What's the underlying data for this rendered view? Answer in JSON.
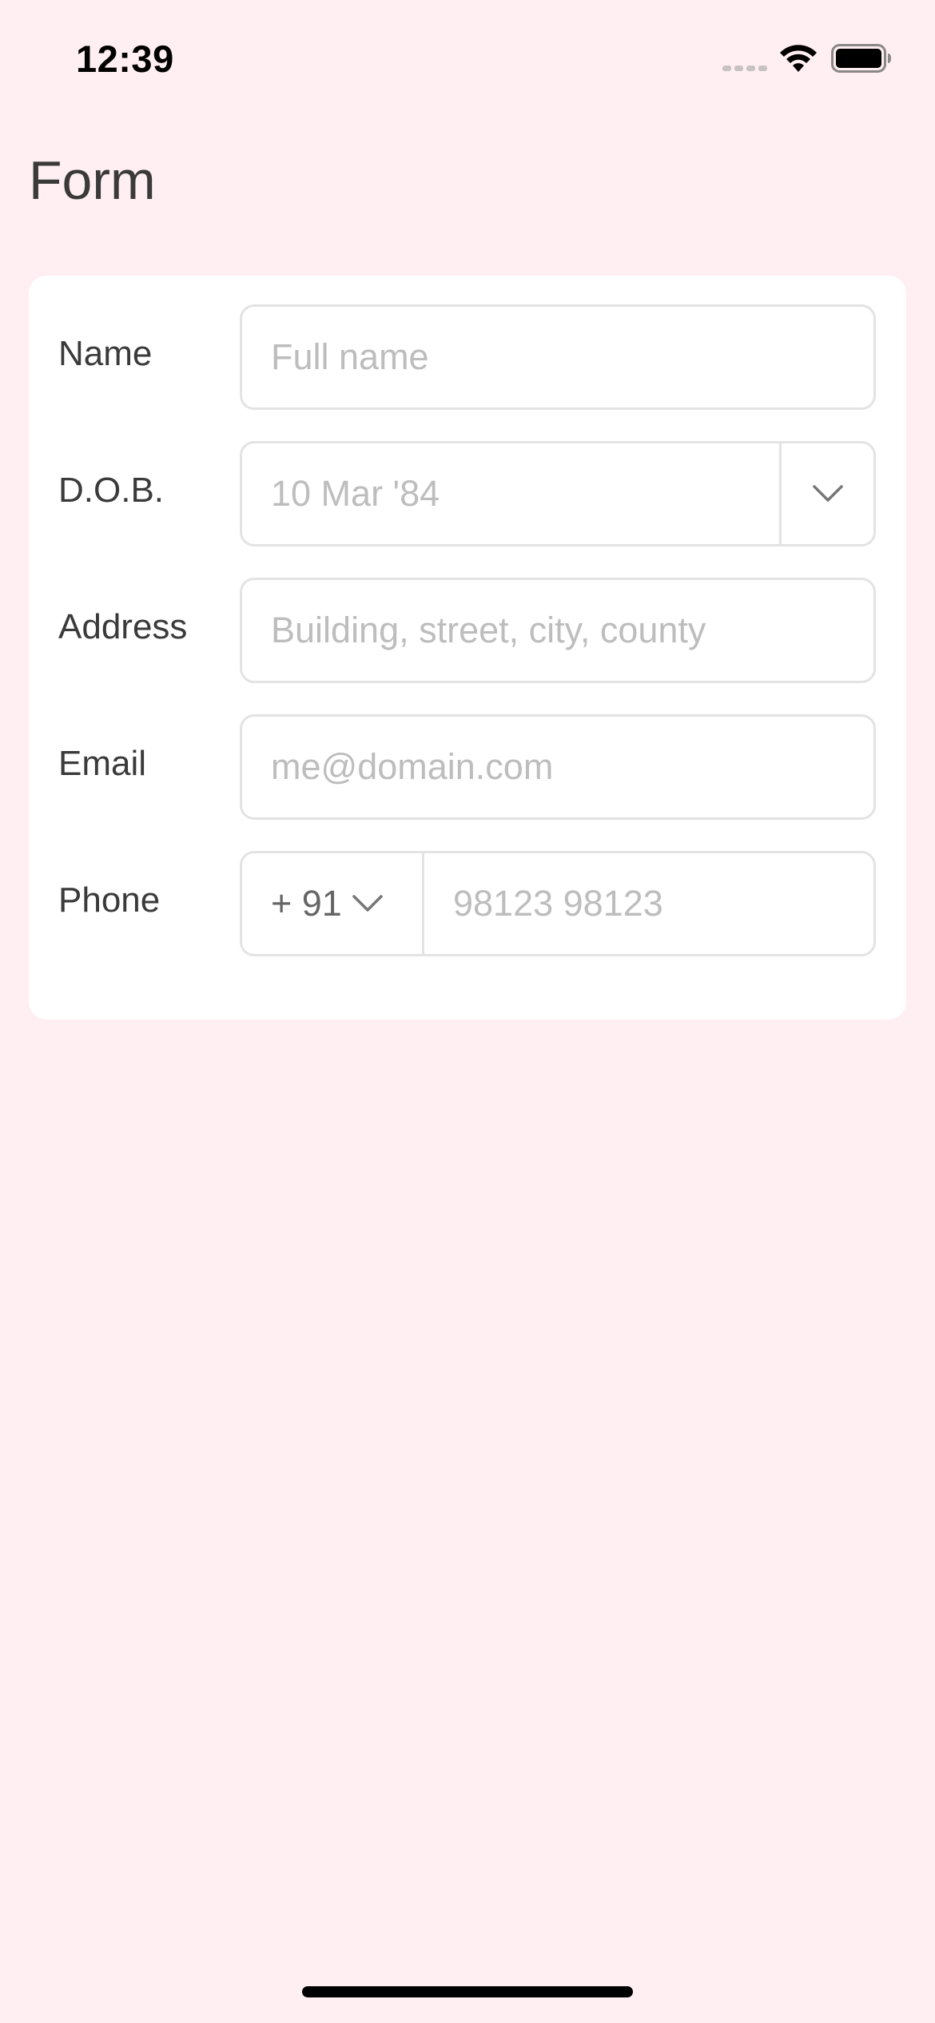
{
  "status_bar": {
    "time": "12:39"
  },
  "title": "Form",
  "form": {
    "name": {
      "label": "Name",
      "placeholder": "Full name"
    },
    "dob": {
      "label": "D.O.B.",
      "placeholder": "10 Mar '84"
    },
    "address": {
      "label": "Address",
      "placeholder": "Building, street, city, county"
    },
    "email": {
      "label": "Email",
      "placeholder": "me@domain.com"
    },
    "phone": {
      "label": "Phone",
      "country_code": "+ 91",
      "placeholder": "98123 98123"
    }
  },
  "icons": {
    "signal": "cellular-signal-icon",
    "wifi": "wifi-icon",
    "battery": "battery-icon",
    "chevron": "chevron-down-icon"
  },
  "colors": {
    "background": "#FFEEF2",
    "card": "#FFFFFF",
    "border": "#E3E3E3",
    "placeholder": "#BDBDBD",
    "text": "#3A3A3A"
  }
}
